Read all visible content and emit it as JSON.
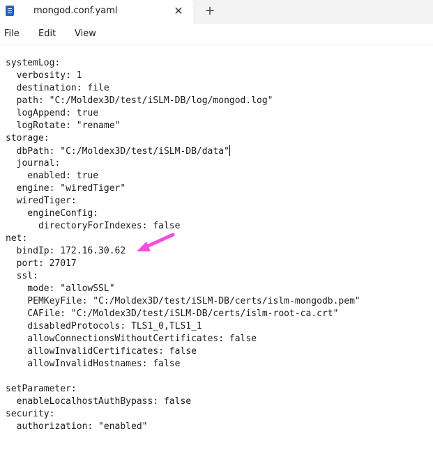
{
  "tab": {
    "title": "mongod.conf.yaml",
    "close_glyph": "✕",
    "new_tab_glyph": "+"
  },
  "menu": {
    "items": [
      "File",
      "Edit",
      "View"
    ]
  },
  "editor": {
    "lines": [
      "systemLog:",
      "  verbosity: 1",
      "  destination: file",
      "  path: \"C:/Moldex3D/test/iSLM-DB/log/mongod.log\"",
      "  logAppend: true",
      "  logRotate: \"rename\"",
      "storage:",
      "  dbPath: \"C:/Moldex3D/test/iSLM-DB/data\"",
      "  journal:",
      "    enabled: true",
      "  engine: \"wiredTiger\"",
      "  wiredTiger:",
      "    engineConfig:",
      "      directoryForIndexes: false",
      "net:",
      "  bindIp: 172.16.30.62",
      "  port: 27017",
      "  ssl:",
      "    mode: \"allowSSL\"",
      "    PEMKeyFile: \"C:/Moldex3D/test/iSLM-DB/certs/islm-mongodb.pem\"",
      "    CAFile: \"C:/Moldex3D/test/iSLM-DB/certs/islm-root-ca.crt\"",
      "    disabledProtocols: TLS1_0,TLS1_1",
      "    allowConnectionsWithoutCertificates: false",
      "    allowInvalidCertificates: false",
      "    allowInvalidHostnames: false",
      "",
      "setParameter:",
      "  enableLocalhostAuthBypass: false",
      "security:",
      "  authorization: \"enabled\""
    ],
    "caret_line": 7
  },
  "annotation": {
    "arrow_color": "#f24ee0",
    "points_to_line": 15,
    "icon": "pink-arrow-icon"
  },
  "colors": {
    "accent_icon": "#1e66c7",
    "text": "#1b1b1b"
  }
}
